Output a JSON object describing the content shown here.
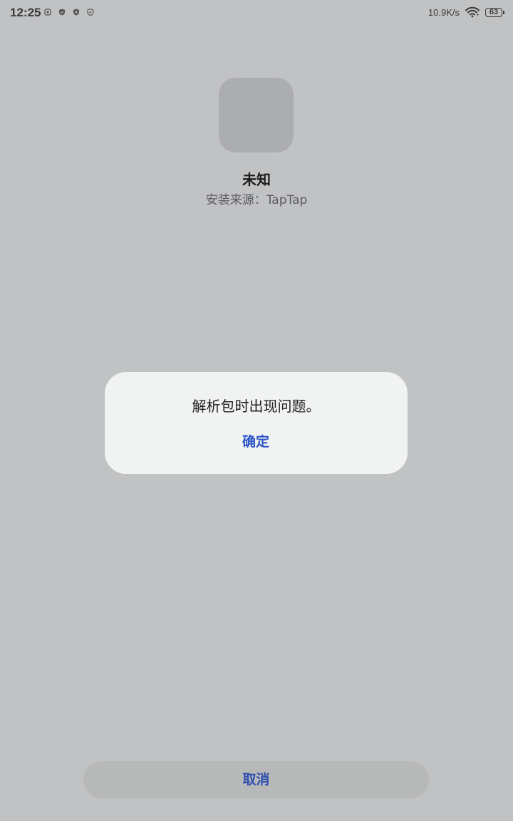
{
  "status_bar": {
    "time": "12:25",
    "net_speed": "10.9K/s",
    "battery_level": "63",
    "notification_icons": [
      "app-notification-icon",
      "shield-icon",
      "shield-icon",
      "check-shield-icon"
    ]
  },
  "app": {
    "name": "未知",
    "install_source": "安装来源：TapTap"
  },
  "dialog": {
    "message": "解析包时出现问题。",
    "confirm_label": "确定"
  },
  "footer": {
    "cancel_label": "取消"
  },
  "colors": {
    "background": "#c1c2c4",
    "dialog_background": "#f1f2f2",
    "accent": "#2e55c7",
    "cancel_button_background": "#b7b8b8"
  }
}
